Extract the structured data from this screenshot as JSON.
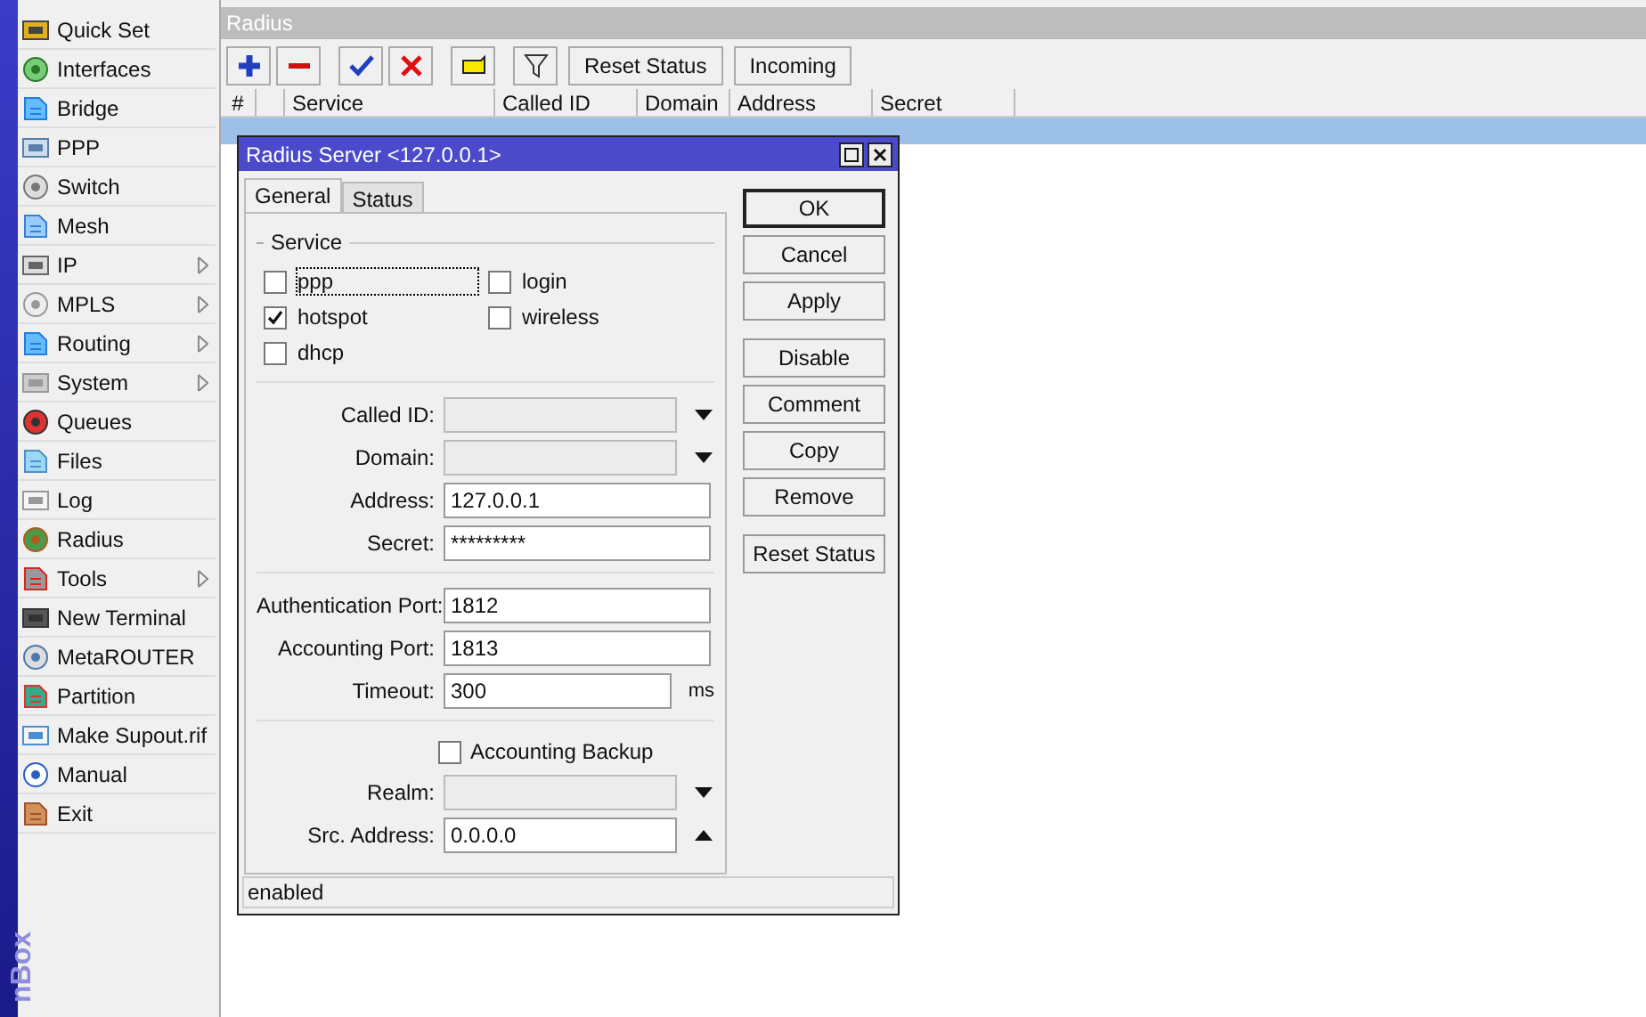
{
  "sidebar": {
    "brand": "nBox",
    "items": [
      {
        "label": "Quick Set",
        "submenu": false
      },
      {
        "label": "Interfaces",
        "submenu": false
      },
      {
        "label": "Bridge",
        "submenu": false
      },
      {
        "label": "PPP",
        "submenu": false
      },
      {
        "label": "Switch",
        "submenu": false
      },
      {
        "label": "Mesh",
        "submenu": false
      },
      {
        "label": "IP",
        "submenu": true
      },
      {
        "label": "MPLS",
        "submenu": true
      },
      {
        "label": "Routing",
        "submenu": true
      },
      {
        "label": "System",
        "submenu": true
      },
      {
        "label": "Queues",
        "submenu": false
      },
      {
        "label": "Files",
        "submenu": false
      },
      {
        "label": "Log",
        "submenu": false
      },
      {
        "label": "Radius",
        "submenu": false
      },
      {
        "label": "Tools",
        "submenu": true
      },
      {
        "label": "New Terminal",
        "submenu": false
      },
      {
        "label": "MetaROUTER",
        "submenu": false
      },
      {
        "label": "Partition",
        "submenu": false
      },
      {
        "label": "Make Supout.rif",
        "submenu": false
      },
      {
        "label": "Manual",
        "submenu": false
      },
      {
        "label": "Exit",
        "submenu": false
      }
    ]
  },
  "window": {
    "title": "Radius"
  },
  "toolbar": {
    "buttons": [
      "Reset Status",
      "Incoming"
    ]
  },
  "table": {
    "columns": [
      "#",
      "",
      "Service",
      "Called ID",
      "Domain",
      "Address",
      "Secret"
    ],
    "rows": [
      {
        "selected": true
      }
    ]
  },
  "dialog": {
    "title": "Radius Server <127.0.0.1>",
    "tabs": [
      {
        "label": "General",
        "selected": true
      },
      {
        "label": "Status",
        "selected": false
      }
    ],
    "service": {
      "title": "Service",
      "options": [
        {
          "label": "ppp",
          "checked": false,
          "focused": true
        },
        {
          "label": "login",
          "checked": false,
          "focused": false
        },
        {
          "label": "hotspot",
          "checked": true,
          "focused": false
        },
        {
          "label": "wireless",
          "checked": false,
          "focused": false
        },
        {
          "label": "dhcp",
          "checked": false,
          "focused": false
        }
      ]
    },
    "sections": [
      [
        {
          "kind": "combo",
          "label": "Called ID:",
          "disabled": true,
          "expanded": false
        },
        {
          "kind": "combo",
          "label": "Domain:",
          "disabled": true,
          "expanded": false
        },
        {
          "kind": "text",
          "label": "Address:",
          "value": "127.0.0.1"
        },
        {
          "kind": "text",
          "label": "Secret:",
          "value": "*********"
        }
      ],
      [
        {
          "kind": "text",
          "label": "Authentication Port:",
          "value": "1812"
        },
        {
          "kind": "text",
          "label": "Accounting Port:",
          "value": "1813"
        },
        {
          "kind": "unit",
          "label": "Timeout:",
          "value": "300",
          "unit": "ms"
        }
      ],
      [
        {
          "kind": "checkbox",
          "label": "Accounting Backup",
          "checked": false
        },
        {
          "kind": "combo",
          "label": "Realm:",
          "disabled": true,
          "expanded": false
        },
        {
          "kind": "combo",
          "label": "Src. Address:",
          "disabled": false,
          "value": "0.0.0.0",
          "expanded": true
        }
      ]
    ],
    "button_groups": [
      [
        {
          "label": "OK",
          "default": true
        },
        {
          "label": "Cancel",
          "default": false
        },
        {
          "label": "Apply",
          "default": false
        }
      ],
      [
        {
          "label": "Disable",
          "default": false
        },
        {
          "label": "Comment",
          "default": false
        },
        {
          "label": "Copy",
          "default": false
        },
        {
          "label": "Remove",
          "default": false
        }
      ],
      [
        {
          "label": "Reset Status",
          "default": false
        }
      ]
    ],
    "status": "enabled"
  }
}
